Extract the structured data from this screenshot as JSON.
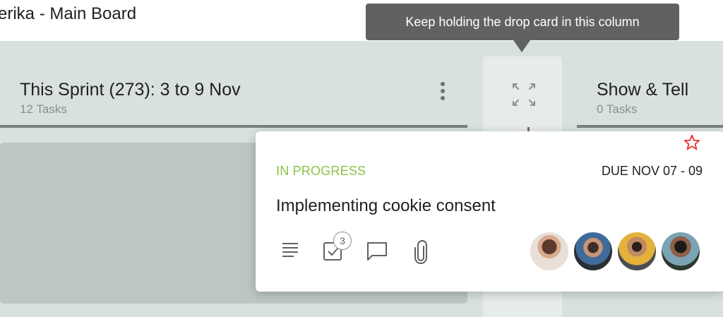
{
  "board": {
    "title": "erika - Main Board"
  },
  "tooltip": {
    "text": "Keep holding the drop card in this column"
  },
  "columns": [
    {
      "title": "This Sprint (273): 3 to 9 Nov",
      "count": "12 Tasks"
    },
    {
      "title": "Show & Tell",
      "count": "0 Tasks"
    }
  ],
  "card": {
    "status": "IN PROGRESS",
    "due": "DUE NOV 07 - 09",
    "title": "Implementing cookie consent",
    "checklist_count": "3",
    "starred": true,
    "avatars": [
      "assignee-1",
      "assignee-2",
      "assignee-3",
      "assignee-4"
    ]
  },
  "colors": {
    "board_bg": "#d8e1dd",
    "status_green": "#8bc34a",
    "star_red": "#e53935",
    "tooltip_bg": "#616161"
  },
  "icons": {
    "column_menu": "more-vert-icon",
    "collapsed_column": "expand-icon",
    "card": [
      "description-icon",
      "checklist-icon",
      "comment-icon",
      "attachment-icon",
      "star-icon"
    ]
  }
}
